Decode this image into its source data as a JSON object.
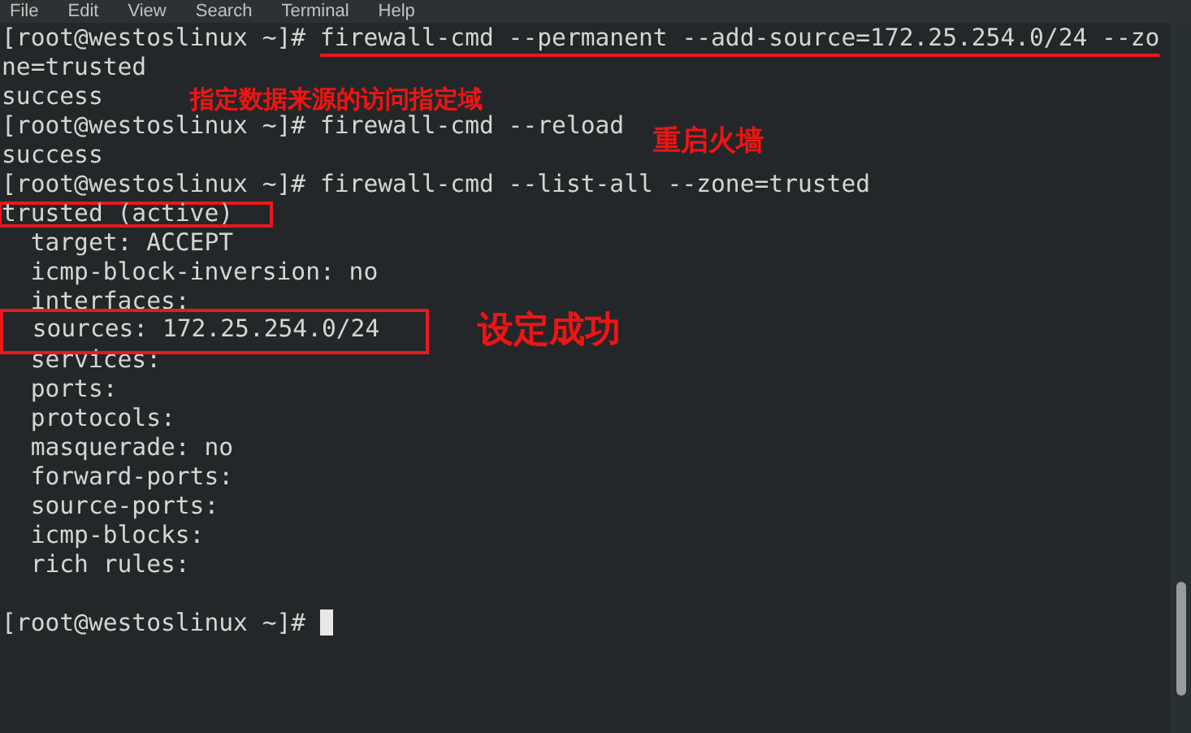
{
  "menu": [
    "File",
    "Edit",
    "View",
    "Search",
    "Terminal",
    "Help"
  ],
  "lines": [
    {
      "kind": "prompt",
      "prompt": "[root@westoslinux ~]#",
      "command": "firewall-cmd --permanent --add-source=172.25.254.0/24 --zo",
      "underlined": true
    },
    {
      "kind": "output",
      "text": "ne=trusted"
    },
    {
      "kind": "output",
      "text": "success"
    },
    {
      "kind": "prompt",
      "prompt": "[root@westoslinux ~]#",
      "command": "firewall-cmd --reload"
    },
    {
      "kind": "output",
      "text": "success"
    },
    {
      "kind": "prompt",
      "prompt": "[root@westoslinux ~]#",
      "command": "firewall-cmd --list-all --zone=trusted"
    },
    {
      "kind": "output",
      "text": "trusted (active)",
      "boxed": true
    },
    {
      "kind": "output",
      "text": "  target: ACCEPT"
    },
    {
      "kind": "output",
      "text": "  icmp-block-inversion: no"
    },
    {
      "kind": "output",
      "text": "  interfaces: "
    },
    {
      "kind": "output",
      "text": "  sources: 172.25.254.0/24",
      "boxed": true
    },
    {
      "kind": "output",
      "text": "  services: "
    },
    {
      "kind": "output",
      "text": "  ports: "
    },
    {
      "kind": "output",
      "text": "  protocols: "
    },
    {
      "kind": "output",
      "text": "  masquerade: no"
    },
    {
      "kind": "output",
      "text": "  forward-ports: "
    },
    {
      "kind": "output",
      "text": "  source-ports: "
    },
    {
      "kind": "output",
      "text": "  icmp-blocks: "
    },
    {
      "kind": "output",
      "text": "  rich rules: "
    },
    {
      "kind": "blank"
    },
    {
      "kind": "prompt",
      "prompt": "[root@westoslinux ~]#",
      "cursor": true
    }
  ],
  "notes": [
    "指定数据来源的访问指定域",
    "重启火墙",
    "设定成功"
  ]
}
